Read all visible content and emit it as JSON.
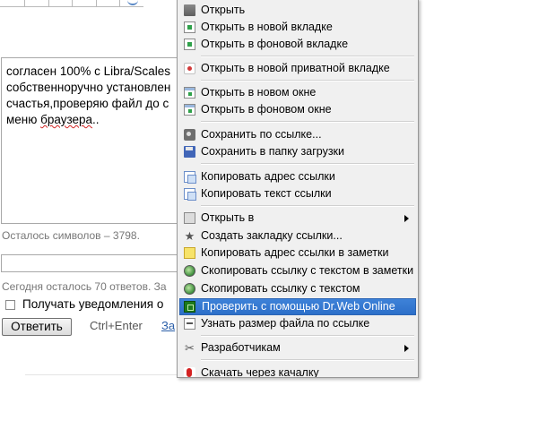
{
  "page": {
    "textarea_lines": [
      "согласен 100% с Libra/Scales",
      "собственноручно установлен",
      "счастья,проверяю файл до с",
      "меню "
    ],
    "textarea_spell_word": "браузера",
    "textarea_tail": "..",
    "chars_left": "Осталось символов – 3798.",
    "answers_left": "Сегодня осталось 70 ответов. За",
    "notify_label": "Получать уведомления о",
    "reply_button": "Ответить",
    "shortcut_hint": "Ctrl+Enter",
    "cut_link": "За"
  },
  "menu": {
    "items": [
      {
        "label": "Открыть",
        "icon": "folder-icon"
      },
      {
        "label": "Открыть в новой вкладке",
        "icon": "new-tab-icon"
      },
      {
        "label": "Открыть в фоновой вкладке",
        "icon": "background-tab-icon"
      },
      {
        "label": "Открыть в новой приватной вкладке",
        "icon": "private-tab-icon"
      },
      {
        "label": "Открыть в новом окне",
        "icon": "new-window-icon"
      },
      {
        "label": "Открыть в фоновом окне",
        "icon": "background-window-icon"
      },
      {
        "label": "Сохранить по ссылке...",
        "icon": "camera-icon"
      },
      {
        "label": "Сохранить в папку загрузки",
        "icon": "save-disk-icon"
      },
      {
        "label": "Копировать адрес ссылки",
        "icon": "copy-address-icon"
      },
      {
        "label": "Копировать текст ссылки",
        "icon": "copy-text-icon"
      },
      {
        "label": "Открыть в",
        "icon": "open-with-icon",
        "submenu": true
      },
      {
        "label": "Создать закладку ссылки...",
        "icon": "bookmark-star-icon"
      },
      {
        "label": "Копировать адрес ссылки в заметки",
        "icon": "notes-icon"
      },
      {
        "label": "Скопировать ссылку с текстом в заметки",
        "icon": "globe-notes-icon"
      },
      {
        "label": "Скопировать ссылку с текстом",
        "icon": "globe-copy-icon"
      },
      {
        "label": "Проверить с помощью Dr.Web Online",
        "icon": "drweb-icon",
        "highlighted": true
      },
      {
        "label": "Узнать размер файла по ссылке",
        "icon": "file-size-icon"
      },
      {
        "label": "Разработчикам",
        "icon": "developer-tools-icon",
        "submenu": true
      },
      {
        "label": "Скачать через качалку",
        "icon": "downloader-icon"
      }
    ]
  },
  "colors": {
    "menu_bg": "#f0f0f0",
    "highlight": "#3e82d8",
    "link": "#2a5ea8"
  }
}
